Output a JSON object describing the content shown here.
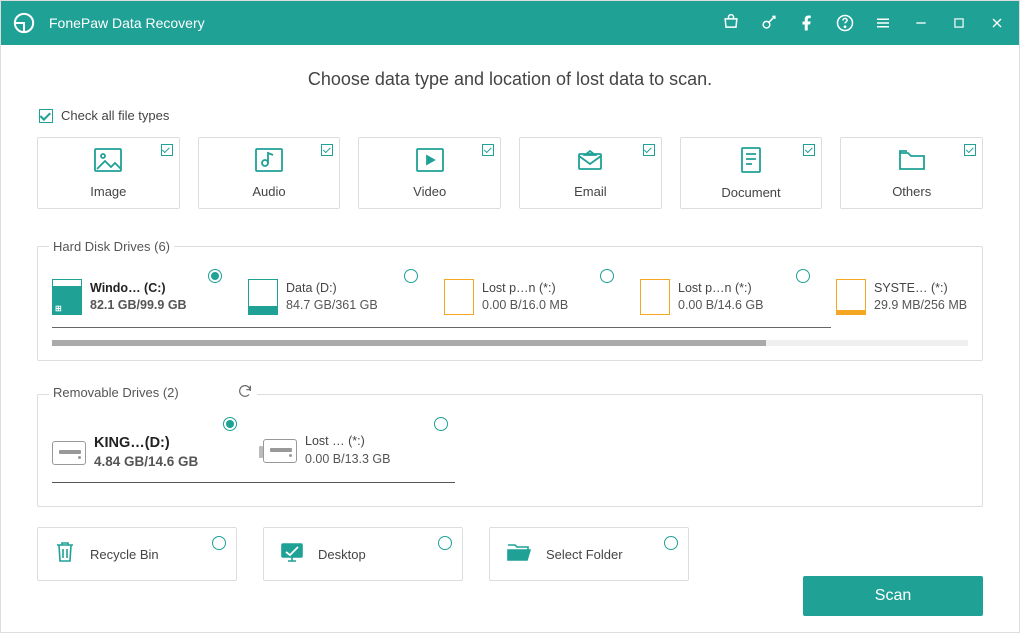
{
  "titlebar": {
    "app_name": "FonePaw Data Recovery"
  },
  "heading": "Choose data type and location of lost data to scan.",
  "check_all_label": "Check all file types",
  "file_types": [
    {
      "id": "image",
      "label": "Image",
      "checked": true
    },
    {
      "id": "audio",
      "label": "Audio",
      "checked": true
    },
    {
      "id": "video",
      "label": "Video",
      "checked": true
    },
    {
      "id": "email",
      "label": "Email",
      "checked": true
    },
    {
      "id": "document",
      "label": "Document",
      "checked": true
    },
    {
      "id": "others",
      "label": "Others",
      "checked": true
    }
  ],
  "hard_drives": {
    "section_label": "Hard Disk Drives (6)",
    "items": [
      {
        "name": "Windo… (C:)",
        "size": "82.1 GB/99.9 GB",
        "selected": true,
        "color": "teal",
        "fill_pct": 82
      },
      {
        "name": "Data (D:)",
        "size": "84.7 GB/361 GB",
        "selected": false,
        "color": "teal",
        "fill_pct": 24
      },
      {
        "name": "Lost p…n (*:)",
        "size": "0.00  B/16.0 MB",
        "selected": false,
        "color": "orange",
        "fill_pct": 0
      },
      {
        "name": "Lost p…n (*:)",
        "size": "0.00  B/14.6 GB",
        "selected": false,
        "color": "orange",
        "fill_pct": 0
      },
      {
        "name": "SYSTE… (*:)",
        "size": "29.9 MB/256 MB",
        "selected": false,
        "color": "orange",
        "fill_pct": 12
      }
    ]
  },
  "removable": {
    "section_label": "Removable Drives (2)",
    "items": [
      {
        "name": "KING…(D:)",
        "size": "4.84 GB/14.6 GB",
        "selected": true
      },
      {
        "name": "Lost … (*:)",
        "size": "0.00  B/13.3 GB",
        "selected": false
      }
    ]
  },
  "locations": [
    {
      "id": "recycle",
      "label": "Recycle Bin"
    },
    {
      "id": "desktop",
      "label": "Desktop"
    },
    {
      "id": "folder",
      "label": "Select Folder"
    }
  ],
  "scan_button": "Scan",
  "colors": {
    "accent": "#1fa196",
    "orange": "#f5a623"
  }
}
